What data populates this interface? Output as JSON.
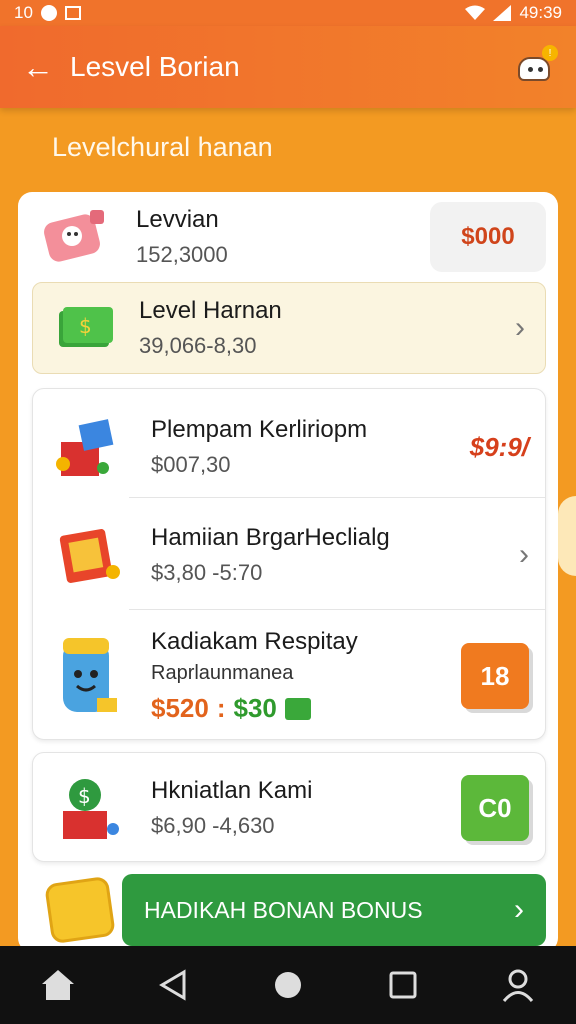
{
  "status_bar": {
    "left_text": "10",
    "time": "49:39"
  },
  "appbar": {
    "title": "Lesvel Borian",
    "back_icon": "arrow-left-icon",
    "robot_icon": "robot-icon",
    "badge": "!"
  },
  "section_title": "Levelchural hanan",
  "summary": {
    "title": "Levvian",
    "subtitle": "152,3000",
    "price": "$000"
  },
  "highlight": {
    "title": "Level Harnan",
    "subtitle": "39,066-8,30"
  },
  "items": [
    {
      "title": "Plempam Kerliriopm",
      "subtitle": "$007,30",
      "price": "$9:9/"
    },
    {
      "title": "Hamiian BrgarHeclialg",
      "subtitle": "$3,80 -5:70"
    }
  ],
  "promo": {
    "title": "Kadiakam Respitay",
    "subtitle": "Raprlaunmanea",
    "price_a": "$520",
    "sep": ":",
    "price_b": "$30",
    "cube": "18"
  },
  "last": {
    "title": "Hkniatlan Kami",
    "subtitle": "$6,90 -4,630",
    "cube": "C0"
  },
  "bonus_button": {
    "label": "HADIKAH BONAN BONUS"
  },
  "colors": {
    "primary": "#f0732b",
    "background": "#f39a22",
    "green": "#2f9a3f",
    "red": "#d6401c"
  }
}
